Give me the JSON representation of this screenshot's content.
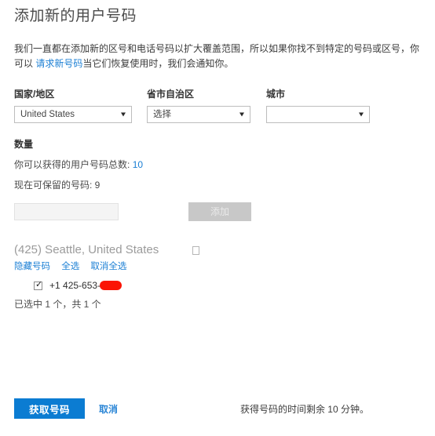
{
  "title": "添加新的用户号码",
  "intro": {
    "text_before_link": "我们一直都在添加新的区号和电话号码以扩大覆盖范围，所以如果你找不到特定的号码或区号，你可以 ",
    "link_label": "请求新号码",
    "text_after_link": "当它们恢复使用时，我们会通知你。"
  },
  "selectors": {
    "country": {
      "label": "国家/地区",
      "value": "United States",
      "caret_icon": "chevron-down-icon"
    },
    "state": {
      "label": "省市自治区",
      "value": "选择",
      "caret_icon": "chevron-down-icon"
    },
    "city": {
      "label": "城市",
      "value": "",
      "caret_icon": "chevron-down-icon"
    }
  },
  "quantity": {
    "section_label": "数量",
    "total_available_label": "你可以获得的用户号码总数:",
    "total_available_value": "10",
    "reservable_label": "现在可保留的号码: 9",
    "input_value": "",
    "add_button_label": "添加"
  },
  "results": {
    "group_title": "(425) Seattle, United States",
    "group_glyph_icon": "box-glyph-icon",
    "links": {
      "hide_numbers": "隐藏号码",
      "select_all": "全选",
      "deselect_all": "取消全选"
    },
    "numbers": [
      {
        "checked": true,
        "checkmark_icon": "check-icon",
        "text": "+1 425-653-",
        "redacted": true
      }
    ],
    "selected_summary": "已选中 1 个，共 1 个"
  },
  "footer": {
    "primary_button_label": "获取号码",
    "cancel_label": "取消",
    "timer_text": "获得号码的时间剩余 10 分钟。"
  },
  "colors": {
    "accent_blue": "#1b7fd4",
    "primary_button": "#0b7cd2",
    "redaction_red": "#fb1405",
    "disabled_gray": "#c8c8c8"
  }
}
